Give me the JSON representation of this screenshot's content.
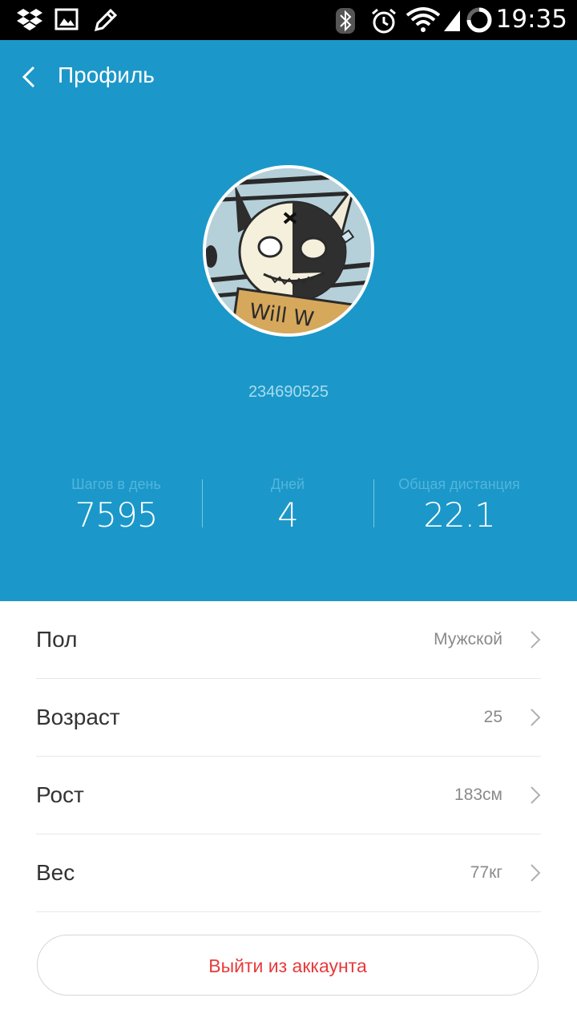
{
  "status_bar": {
    "time": "19:35",
    "left_icons": [
      "dropbox-icon",
      "image-icon",
      "pencil-icon"
    ],
    "right_icons": [
      "bluetooth-icon",
      "alarm-icon",
      "wifi-icon",
      "battery-icon"
    ]
  },
  "header": {
    "title": "Профиль",
    "back_icon": "chevron-left-icon",
    "background_color": "#1b98c9",
    "user_id": "234690525",
    "avatar_text": "Will W"
  },
  "stats": [
    {
      "label": "Шагов в день",
      "value": "7595"
    },
    {
      "label": "Дней",
      "value": "4"
    },
    {
      "label": "Общая дистанция",
      "value": "22.1"
    }
  ],
  "settings": [
    {
      "label": "Пол",
      "value": "Мужской"
    },
    {
      "label": "Возраст",
      "value": "25"
    },
    {
      "label": "Рост",
      "value": "183см"
    },
    {
      "label": "Вес",
      "value": "77кг"
    }
  ],
  "logout": {
    "label": "Выйти из аккаунта",
    "color": "#e83a3a"
  }
}
